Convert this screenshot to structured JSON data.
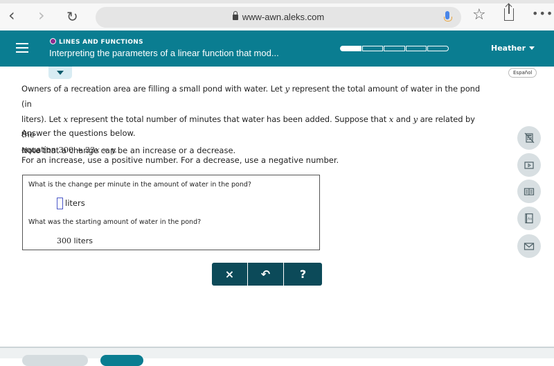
{
  "browser": {
    "url": "www-awn.aleks.com",
    "back_icon": "‹",
    "forward_icon": "›",
    "reload_icon": "↻",
    "star_icon": "☆",
    "more_icon": "•••"
  },
  "header": {
    "topic": "LINES AND FUNCTIONS",
    "lesson_title": "Interpreting the parameters of a linear function that mod...",
    "progress": {
      "segments": 5,
      "filled": 1
    },
    "user_name": "Heather",
    "colors": {
      "header_bg": "#0a7d91",
      "topic_dot": "#8b2b8e",
      "action_btn": "#0c4a59"
    }
  },
  "language_button": "Español",
  "problem": {
    "line1_a": "Owners of a recreation area are filling a small pond with water. Let ",
    "var_y": "y",
    "line1_b": " represent the total amount of water in the pond (in",
    "line2_a": "liters). Let ",
    "var_x": "x",
    "line2_b": " represent the total number of minutes that water has been added. Suppose that ",
    "line2_c": " and ",
    "line2_d": " are related by the",
    "line3_a": "equation ",
    "equation_num": "300 + 33",
    "equation_rest": " = y.",
    "answer_prompt": "Answer the questions below.",
    "note1": "Note that a change can be an increase or a decrease.",
    "note2": "For an increase, use a positive number. For a decrease, use a negative number."
  },
  "questions": [
    {
      "label": "What is the change per minute in the amount of water in the pond?",
      "value": "",
      "unit": "liters"
    },
    {
      "label": "What was the starting amount of water in the pond?",
      "value": "300",
      "unit": "liters"
    }
  ],
  "actions": {
    "clear": "×",
    "undo": "↶",
    "help": "?"
  }
}
